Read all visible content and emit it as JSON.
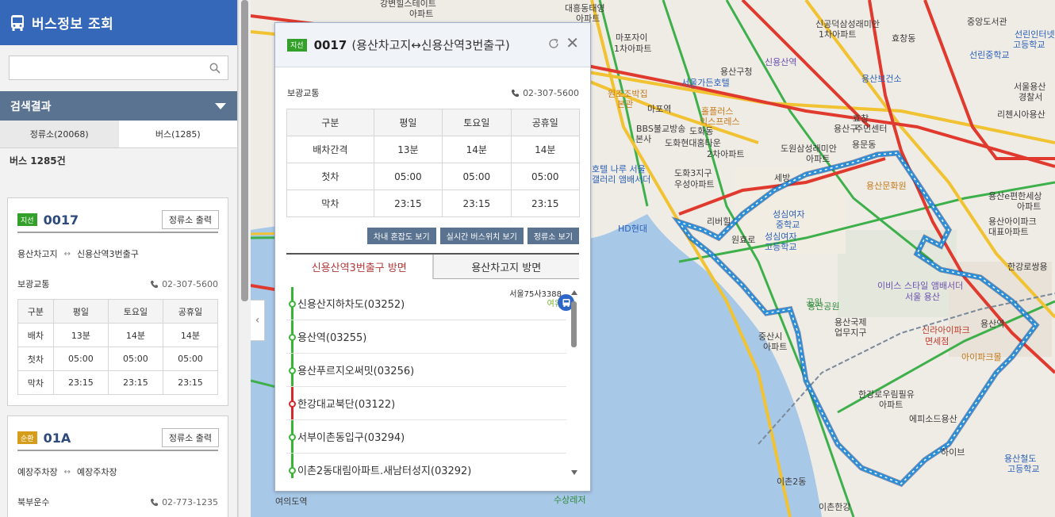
{
  "sidebar": {
    "title": "버스정보 조회",
    "search": {
      "value": "",
      "placeholder": ""
    },
    "results_label": "검색결과",
    "tabs": [
      {
        "label": "정류소(20068)",
        "active": false
      },
      {
        "label": "버스(1285)",
        "active": true
      }
    ],
    "count": "버스 1285건",
    "cards": [
      {
        "badge": "지선",
        "badge_color": "#33a029",
        "route_no": "0017",
        "print_label": "정류소 출력",
        "start": "용산차고지",
        "end": "신용산역3번출구",
        "company": "보광교통",
        "phone": "02-307-5600",
        "table": {
          "headers": [
            "구분",
            "평일",
            "토요일",
            "공휴일"
          ],
          "rows": [
            [
              "배차",
              "13분",
              "14분",
              "14분"
            ],
            [
              "첫차",
              "05:00",
              "05:00",
              "05:00"
            ],
            [
              "막차",
              "23:15",
              "23:15",
              "23:15"
            ]
          ]
        }
      },
      {
        "badge": "순환",
        "badge_color": "#d59d1a",
        "route_no": "01A",
        "print_label": "정류소 출력",
        "start": "예장주차장",
        "end": "예장주차장",
        "company": "북부운수",
        "phone": "02-773-1235"
      }
    ]
  },
  "popup": {
    "badge": "지선",
    "route_no": "0017",
    "route_name": "(용산차고지↔신용산역3번출구)",
    "company": "보광교통",
    "phone": "02-307-5600",
    "table": {
      "headers": [
        "구분",
        "평일",
        "토요일",
        "공휴일"
      ],
      "rows": [
        [
          "배차간격",
          "13분",
          "14분",
          "14분"
        ],
        [
          "첫차",
          "05:00",
          "05:00",
          "05:00"
        ],
        [
          "막차",
          "23:15",
          "23:15",
          "23:15"
        ]
      ]
    },
    "buttons": [
      "차내 혼잡도 보기",
      "실시간 버스위치 보기",
      "정류소 보기"
    ],
    "directions": [
      {
        "label": "신용산역3번출구 방면",
        "active": true
      },
      {
        "label": "용산차고지 방면",
        "active": false
      }
    ],
    "stops": [
      {
        "name": "신용산지하차도(03252)",
        "line": "green"
      },
      {
        "name": "용산역(03255)",
        "line": "green"
      },
      {
        "name": "용산푸르지오써밋(03256)",
        "line": "green"
      },
      {
        "name": "한강대교북단(03122)",
        "line": "red"
      },
      {
        "name": "서부이촌동입구(03294)",
        "line": "green"
      },
      {
        "name": "이촌2동대림아파트.새남터성지(03292)",
        "line": "green"
      }
    ],
    "bus": {
      "plate": "서울75사3388",
      "crowd": "여유"
    }
  },
  "map": {
    "labels": [
      "강변힐스테이트",
      "아파트",
      "대흥동태영",
      "아파트",
      "마포자이",
      "1차아파트",
      "원조조박집",
      "본관",
      "서울가든호텔",
      "마포역",
      "홀플러스",
      "익스프레스",
      "BBS불교방송",
      "본사",
      "도화동",
      "도화현대홈타운",
      "2차아파트",
      "호텔 나루 서울",
      "갤러리 앰배서더",
      "도화3지구",
      "우성아파트",
      "세방",
      "HD현대",
      "리버힐",
      "원효로",
      "성심여자",
      "중학교",
      "성심여자",
      "고등학교",
      "용산문화원",
      "신공덕삼성래미안",
      "1차아파트",
      "효창동",
      "효창",
      "주민센터",
      "용산구",
      "용문동",
      "도원삼성래미안",
      "아파트",
      "용산보건소",
      "신용산역",
      "용산구청",
      "용산공원",
      "중앙도서관",
      "선린인터넷",
      "고등학교",
      "선린중학교",
      "서울용산",
      "경찰서",
      "리첸시아용산",
      "용산e편한세상",
      "아파트",
      "용산아이파크",
      "대표아파트",
      "한강로쌍용",
      "이비스 스타일 앰배서더",
      "서울 용산",
      "용산역",
      "신라아이파크",
      "면세점",
      "아이파크몰",
      "한강로우림필유",
      "아파트",
      "에피소드용산",
      "하이브",
      "용산철도",
      "고등학교",
      "이촌2동",
      "이촌한강",
      "여의도역",
      "수상레저",
      "용산국제",
      "업무지구",
      "중산시",
      "아파트",
      "공원"
    ],
    "colors": {
      "road_major": "#e03a2f",
      "road_mid": "#f1c232",
      "road_minor": "#3eb04b",
      "river": "#a8c8e8",
      "route": "#2a8fd8"
    }
  }
}
